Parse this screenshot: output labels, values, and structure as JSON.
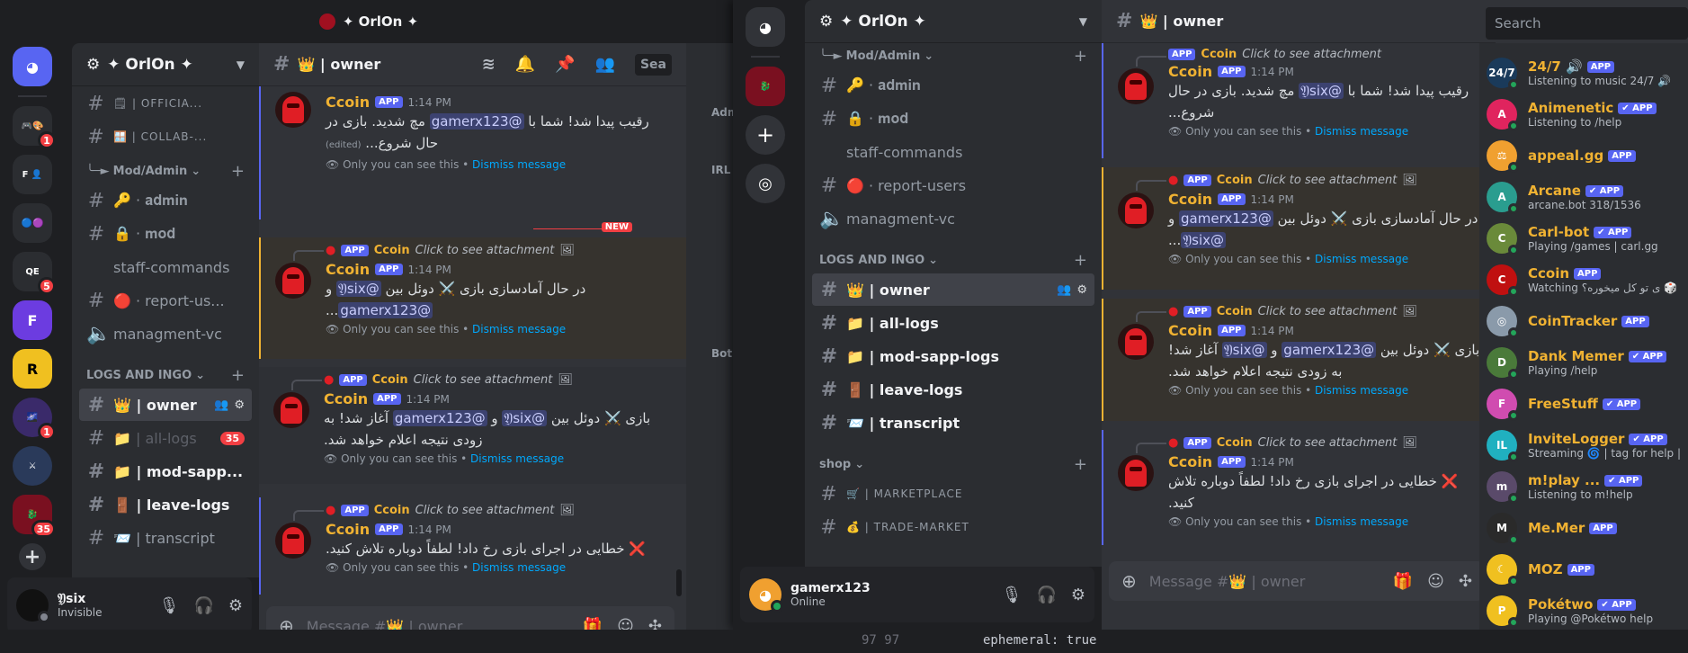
{
  "winA": {
    "title": "✦ OrlOn ✦",
    "server_name": "✦ OrlOn ✦",
    "guild_badges": [
      "1",
      "5",
      "1",
      "35"
    ],
    "channels": [
      {
        "name": "🗒 | OFFICIA...",
        "style": "small"
      },
      {
        "name": "🪟 | COLLAB-...",
        "style": "small"
      },
      {
        "name": "Mod/Admin",
        "style": "cat"
      },
      {
        "name": "🔑 · 𝐚𝐝𝐦𝐢𝐧",
        "style": ""
      },
      {
        "name": "🔒 · 𝐦𝐨𝐝",
        "style": ""
      },
      {
        "name": "staff-commands",
        "style": ""
      },
      {
        "name": "🔴 · report-us...",
        "style": ""
      }
    ],
    "voice_channel": "managment-vc",
    "category_logs": "LOGS AND INGO",
    "active_channel": "👑 | owner",
    "log_channels": [
      {
        "name": "📁 | all-logs",
        "badge": "35",
        "muted": true
      },
      {
        "name": "📁 | mod-sapp...",
        "bold": true
      },
      {
        "name": "🚪 | leave-logs",
        "bold": true
      },
      {
        "name": "📨 | transcript",
        "bold": false
      }
    ],
    "user": {
      "name": "𝔜six",
      "status": "Invisible"
    },
    "header_channel": "👑 | owner",
    "header_search": "Sea",
    "composer_placeholder": "Message #👑 | owner",
    "new_label": "NEW",
    "side_labels": [
      "Adm",
      "IRL",
      "Bot"
    ],
    "messages": [
      {
        "time": "1:14 PM",
        "body_a": "رقیب پیدا شد! شما با ",
        "mention1": "@gamerx123",
        "body_b": " مچ شدید. بازی در حال شروع...",
        "edited": "(edited)",
        "reply": false
      },
      {
        "time": "1:14 PM",
        "body_a": "در حال آمادسازی بازی ⚔️ دوئل بین ",
        "mention1": "@𝔜six",
        "body_b": " و ",
        "mention2": "@gamerx123",
        "body_c": "...",
        "reply": true
      },
      {
        "time": "1:14 PM",
        "body_a": "بازی ⚔️ دوئل بین ",
        "mention1": "@𝔜six",
        "body_b": " و ",
        "mention2": "@gamerx123",
        "body_c": " آغاز شد! به زودی نتیجه اعلام خواهد شد.",
        "reply": true
      },
      {
        "time": "1:14 PM",
        "body_a": "❌ خطایی در اجرای بازی رخ داد! لطفاً دوباره تلاش کنید.",
        "reply": true
      }
    ]
  },
  "winB": {
    "server_name": "✦ OrlOn ✦",
    "channels_top": [
      {
        "name": "Mod/Admin",
        "style": "cat"
      },
      {
        "name": "🔑 · 𝐚𝐝𝐦𝐢𝐧",
        "style": ""
      },
      {
        "name": "🔒 · 𝐦𝐨𝐝",
        "style": ""
      },
      {
        "name": "staff-commands",
        "style": ""
      },
      {
        "name": "🔴 · report-users",
        "style": ""
      }
    ],
    "voice_channel": "managment-vc",
    "category_logs": "LOGS AND INGO",
    "active_channel": "👑 | owner",
    "log_channels": [
      "📁 | all-logs",
      "📁 | mod-sapp-logs",
      "🚪 | leave-logs",
      "📨 | transcript"
    ],
    "category_shop": "shop",
    "shop_channels": [
      "🛒 | MARKETPLACE",
      "💰 | TRADE-MARKET"
    ],
    "user": {
      "name": "gamerx123",
      "status": "Online"
    },
    "header_channel": "👑 | owner",
    "search_placeholder": "Search",
    "composer_placeholder": "Message #👑 | owner",
    "messages": [
      {
        "time": "1:14 PM",
        "body_a": "رقیب پیدا شد! شما با ",
        "mention1": "@𝔜six",
        "body_b": " مچ شدید. بازی در حال شروع..."
      },
      {
        "time": "1:14 PM",
        "body_a": "در حال آمادسازی بازی ⚔️ دوئل بین ",
        "mention1": "@gamerx123",
        "body_b": " و ",
        "mention2": "@𝔜six",
        "body_c": "..."
      },
      {
        "time": "1:14 PM",
        "body_a": "بازی ⚔️ دوئل بین ",
        "mention1": "@gamerx123",
        "body_b": " و ",
        "mention2": "@𝔜six",
        "body_c": " آغاز شد! به زودی نتیجه اعلام خواهد شد."
      },
      {
        "time": "1:14 PM",
        "body_a": "❌ خطایی در اجرای بازی رخ داد! لطفاً دوباره تلاش کنید."
      }
    ],
    "members": [
      {
        "name": "24/7 🔊",
        "status": "Listening to music 24/7 🔊",
        "color": "#f0b232",
        "av": "#1a3a5a",
        "avtext": "24/7"
      },
      {
        "name": "Animenetic",
        "status": "Listening to /help",
        "color": "#f0b232",
        "av": "#e0245e",
        "avtext": "A",
        "verified": true
      },
      {
        "name": "appeal.gg",
        "status": "",
        "color": "#f0b232",
        "av": "#f0a030",
        "avtext": "⚖"
      },
      {
        "name": "Arcane",
        "status": "arcane.bot 318/1536",
        "color": "#f0b232",
        "av": "#2a9d8f",
        "avtext": "A",
        "verified": true
      },
      {
        "name": "Carl-bot",
        "status": "Playing /games | carl.gg",
        "color": "#f0b232",
        "av": "#6a8a3a",
        "avtext": "C",
        "verified": true
      },
      {
        "name": "Ccoin",
        "status": "Watching ی تو کل میخوره؟ 🎲",
        "color": "#f0b232",
        "av": "#c01010",
        "avtext": "C"
      },
      {
        "name": "CoinTracker",
        "status": "",
        "color": "#f0b232",
        "av": "#8a9aaa",
        "avtext": "◎"
      },
      {
        "name": "Dank Memer",
        "status": "Playing /help",
        "color": "#f0b232",
        "av": "#4a7a3a",
        "avtext": "D",
        "verified": true
      },
      {
        "name": "FreeStuff",
        "status": "",
        "color": "#f0b232",
        "av": "#d04cb0",
        "avtext": "F",
        "verified": true
      },
      {
        "name": "InviteLogger",
        "status": "Streaming 🌀 | tag for help |",
        "color": "#f0b232",
        "av": "#20b0c0",
        "avtext": "IL",
        "verified": true
      },
      {
        "name": "m!play ...",
        "status": "Listening to m!help",
        "color": "#f0b232",
        "av": "#5a4a6a",
        "avtext": "m",
        "verified": true
      },
      {
        "name": "Me.Mer",
        "status": "",
        "color": "#f0b232",
        "av": "#2a2a2a",
        "avtext": "M"
      },
      {
        "name": "MOZ",
        "status": "",
        "color": "#f0b232",
        "av": "#f0c020",
        "avtext": "☾"
      },
      {
        "name": "Pokétwo",
        "status": "Playing @Pokétwo help",
        "color": "#f0b232",
        "av": "#f0c020",
        "avtext": "P",
        "verified": true
      }
    ],
    "code_lines": [
      "97  97",
      "ephemeral: true"
    ]
  },
  "labels": {
    "app": "APP",
    "ccoin": "Ccoin",
    "attach": "Click to see attachment",
    "only_you": "Only you can see this • ",
    "dismiss": "Dismiss message",
    "app_check": "✔ APP"
  },
  "colors": {
    "accent": "#5865f2",
    "mention_bg": "#3c4270",
    "highlight": "#f0b232",
    "red": "#f23f43",
    "green": "#23a55a"
  }
}
